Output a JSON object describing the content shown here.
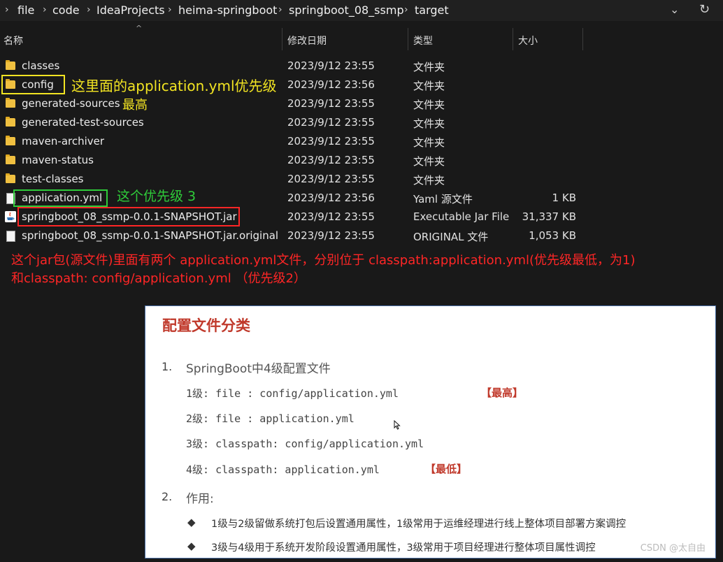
{
  "breadcrumb": [
    "file",
    "code",
    "IdeaProjects",
    "heima-springboot",
    "springboot_08_ssmp",
    "target"
  ],
  "breadcrumb_separator": "›",
  "addr_buttons": {
    "dropdown": "⌄",
    "refresh": "↻"
  },
  "columns": {
    "name": "名称",
    "date": "修改日期",
    "type": "类型",
    "size": "大小"
  },
  "sort_indicator": "^",
  "files": [
    {
      "name": "classes",
      "date": "2023/9/12 23:55",
      "type": "文件夹",
      "size": "",
      "icon": "folder-icon"
    },
    {
      "name": "config",
      "date": "2023/9/12 23:56",
      "type": "文件夹",
      "size": "",
      "icon": "folder-icon"
    },
    {
      "name": "generated-sources",
      "date": "2023/9/12 23:55",
      "type": "文件夹",
      "size": "",
      "icon": "folder-icon"
    },
    {
      "name": "generated-test-sources",
      "date": "2023/9/12 23:55",
      "type": "文件夹",
      "size": "",
      "icon": "folder-icon"
    },
    {
      "name": "maven-archiver",
      "date": "2023/9/12 23:55",
      "type": "文件夹",
      "size": "",
      "icon": "folder-icon"
    },
    {
      "name": "maven-status",
      "date": "2023/9/12 23:55",
      "type": "文件夹",
      "size": "",
      "icon": "folder-icon"
    },
    {
      "name": "test-classes",
      "date": "2023/9/12 23:55",
      "type": "文件夹",
      "size": "",
      "icon": "folder-icon"
    },
    {
      "name": "application.yml",
      "date": "2023/9/12 23:56",
      "type": "Yaml 源文件",
      "size": "1 KB",
      "icon": "file-icon"
    },
    {
      "name": "springboot_08_ssmp-0.0.1-SNAPSHOT.jar",
      "date": "2023/9/12 23:55",
      "type": "Executable Jar File",
      "size": "31,337 KB",
      "icon": "java-jar-icon"
    },
    {
      "name": "springboot_08_ssmp-0.0.1-SNAPSHOT.jar.original",
      "date": "2023/9/12 23:55",
      "type": "ORIGINAL 文件",
      "size": "1,053 KB",
      "icon": "file-icon"
    }
  ],
  "annotations": {
    "config_note": "这里面的application.yml优先级",
    "config_note_2": "最高",
    "yml_note": "这个优先级 3",
    "jar_note_line1": "这个jar包(源文件)里面有两个 application.yml文件，分别位于 classpath:application.yml(优先级最低，为1)",
    "jar_note_line2": "和classpath: config/application.yml （优先级2）"
  },
  "colors": {
    "yellow": "#f2e422",
    "green": "#2fcc3a",
    "red": "#ff2626",
    "title_red": "#c0392b"
  },
  "panel": {
    "title": "配置文件分类",
    "item1_num": "1.",
    "item1_label": "SpringBoot中4级配置文件",
    "levels": [
      {
        "text": "1级:  file : config/application.yml",
        "tag": "【最高】"
      },
      {
        "text": "2级:  file : application.yml",
        "tag": ""
      },
      {
        "text": "3级: classpath: config/application.yml",
        "tag": ""
      },
      {
        "text": "4级: classpath: application.yml",
        "tag": "【最低】"
      }
    ],
    "item2_num": "2.",
    "item2_label": "作用:",
    "bullet_glyph": "◆",
    "bullets": [
      "1级与2级留做系统打包后设置通用属性，1级常用于运维经理进行线上整体项目部署方案调控",
      "3级与4级用于系统开发阶段设置通用属性，3级常用于项目经理进行整体项目属性调控"
    ],
    "watermark": "CSDN @太自由"
  }
}
